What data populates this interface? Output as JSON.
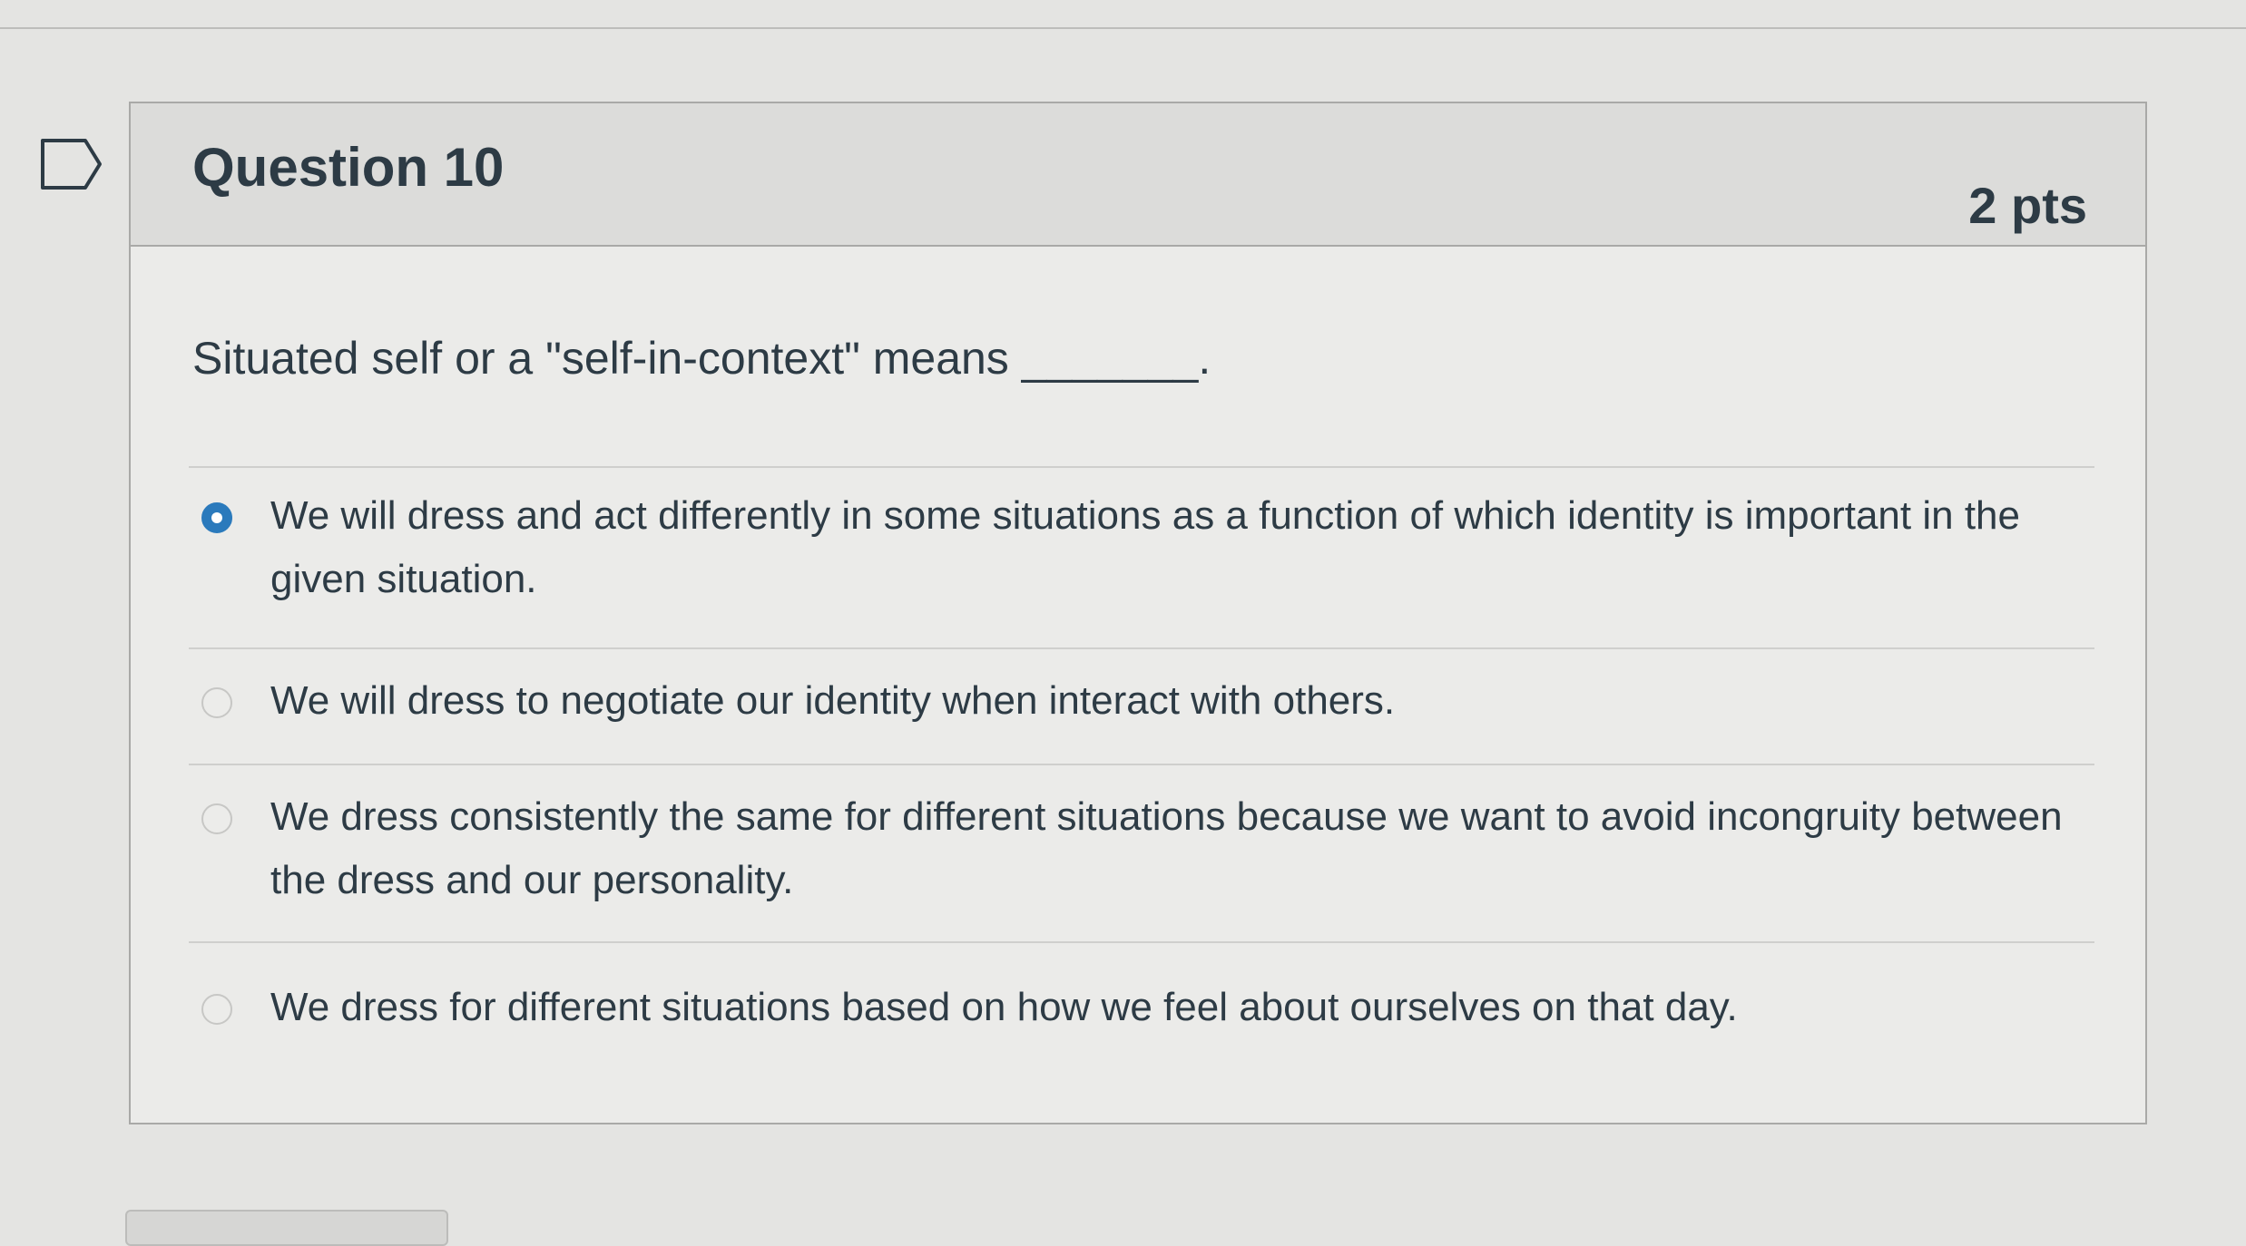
{
  "question": {
    "title": "Question 10",
    "points": "2 pts",
    "text": "Situated self or a \"self-in-context\" means _______.",
    "bookmark_icon": "bookmark-flag-icon"
  },
  "answers": [
    {
      "label": "We will dress and act differently in some situations as a function of which identity is important in the given situation.",
      "selected": true
    },
    {
      "label": "We will dress to negotiate our identity when interact with others.",
      "selected": false
    },
    {
      "label": "We dress consistently the same for different situations because we want to avoid incongruity between the dress and our personality.",
      "selected": false
    },
    {
      "label": "We dress for different situations based on how we feel about ourselves on that day.",
      "selected": false
    }
  ],
  "colors": {
    "accent": "#2b7abc",
    "text": "#2d3b45",
    "header_bg": "#dcdcda",
    "card_bg": "#ebebe9"
  }
}
